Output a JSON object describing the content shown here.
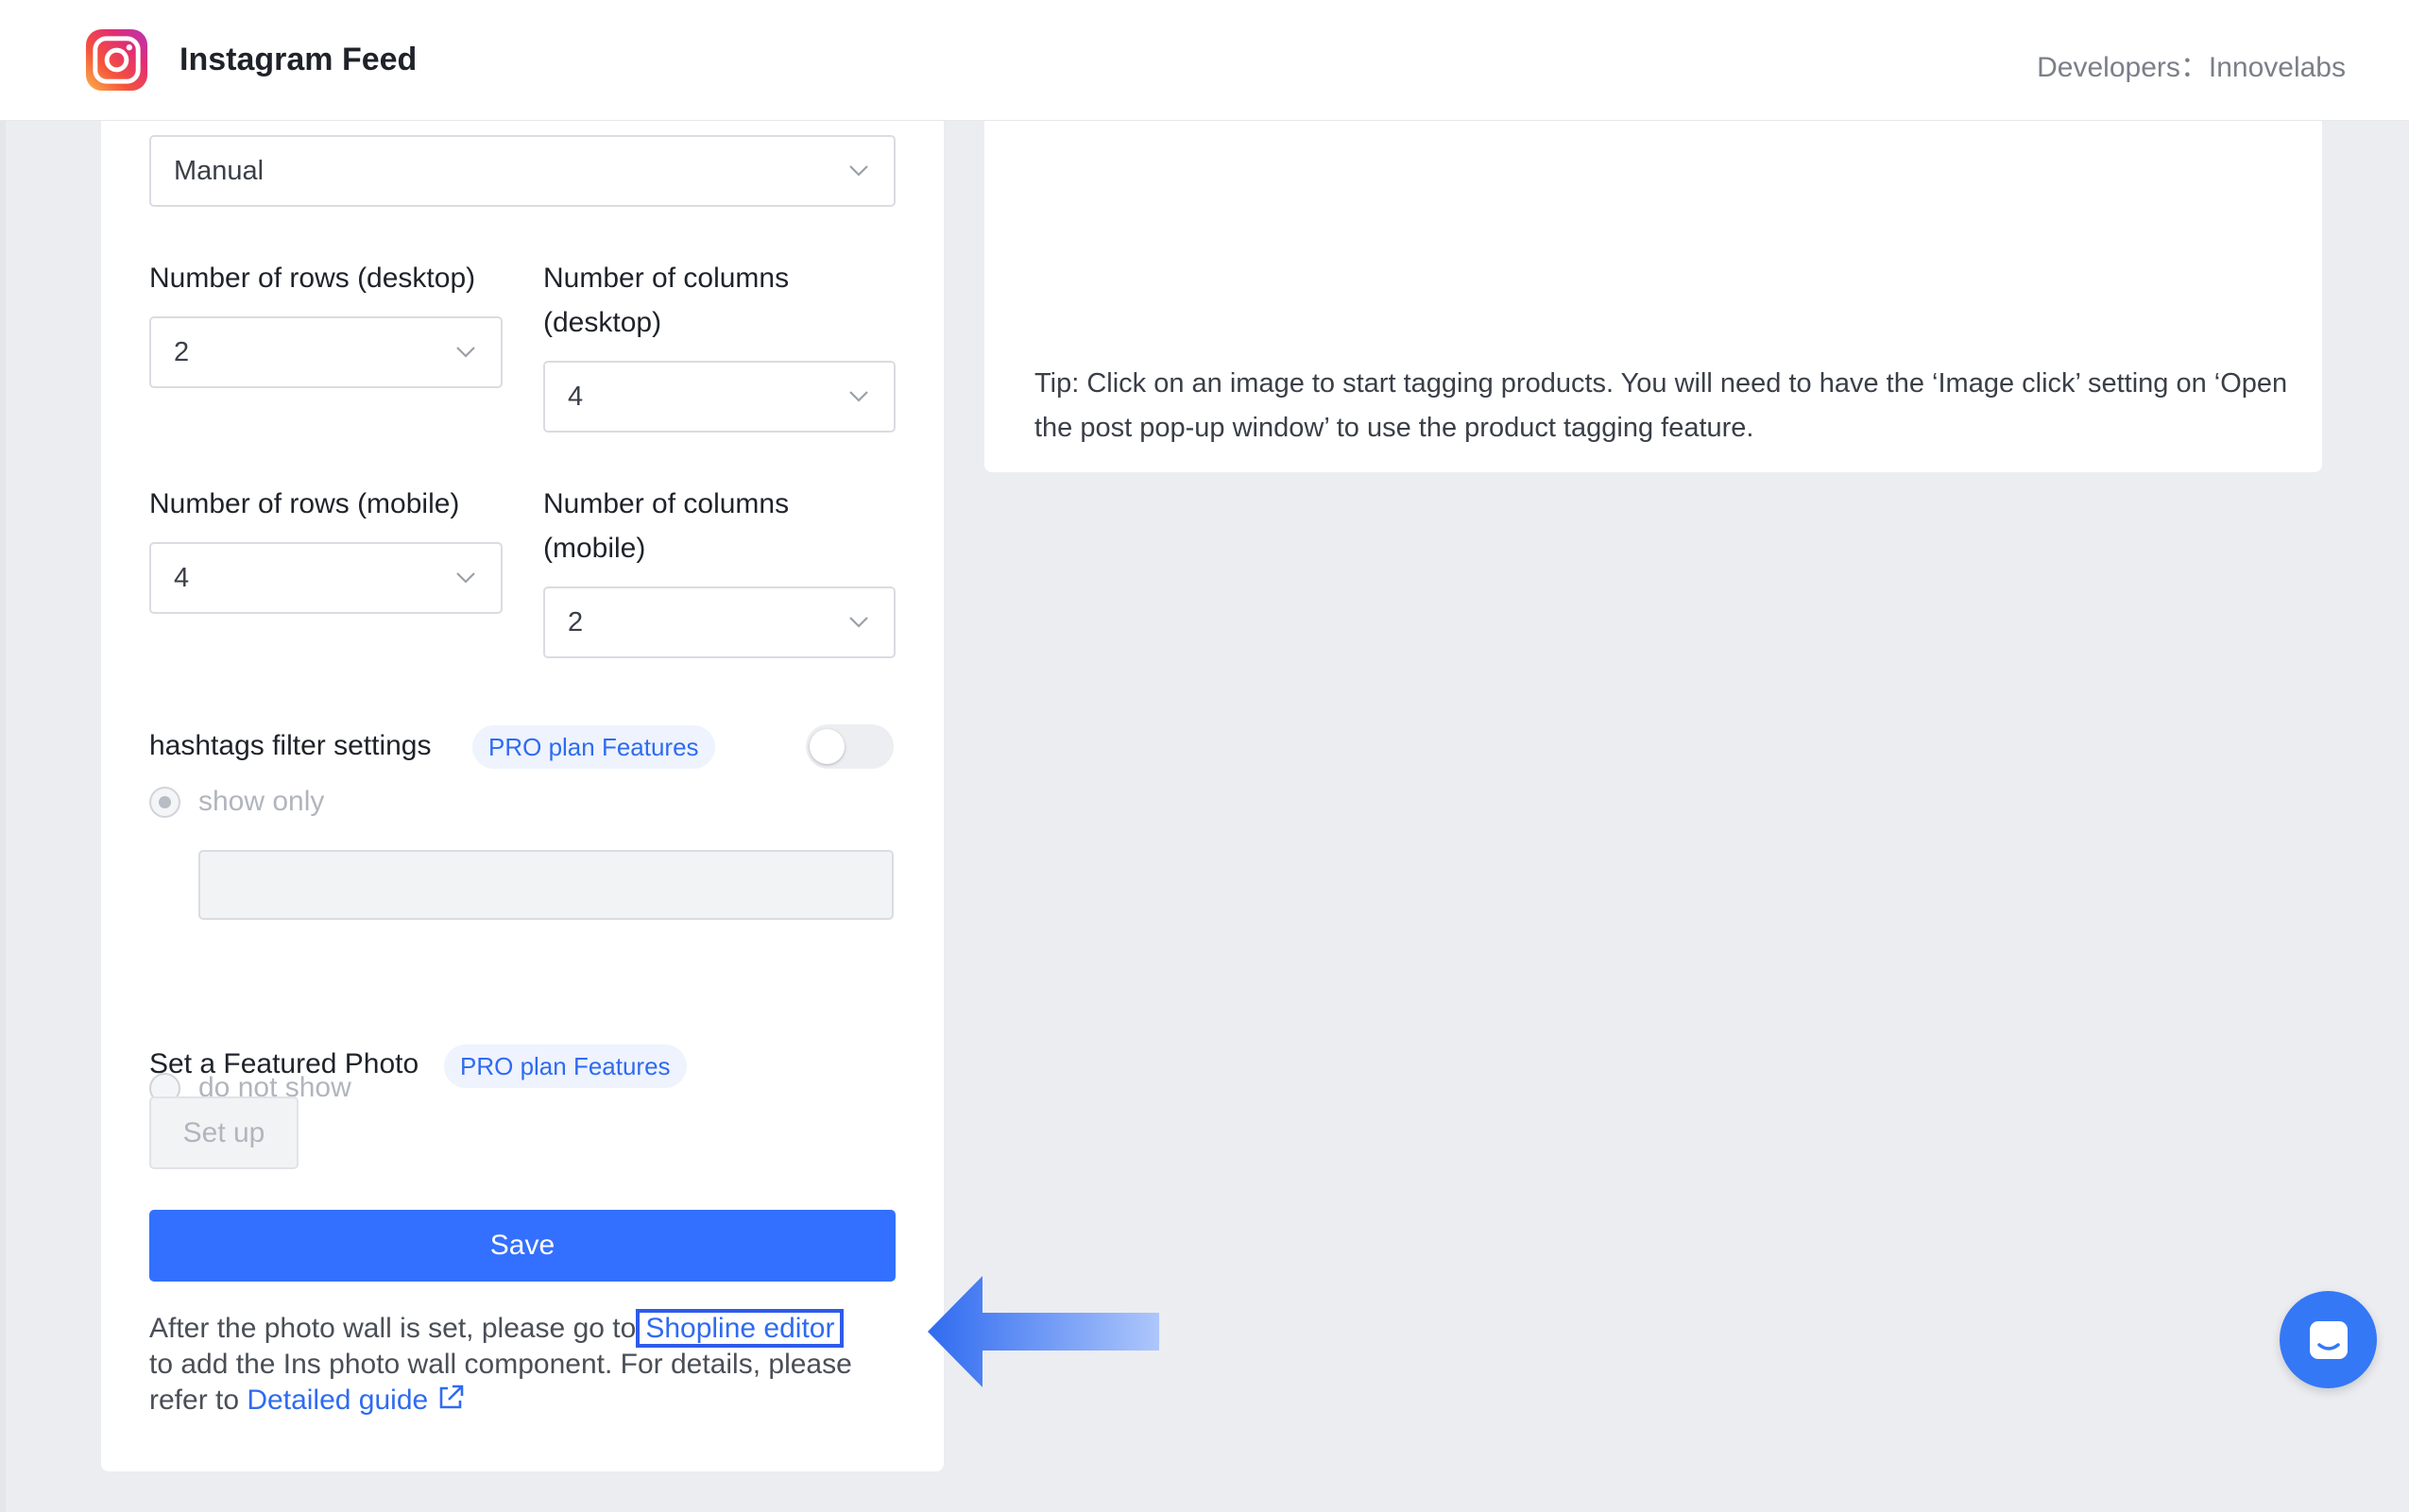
{
  "header": {
    "app_title": "Instagram Feed",
    "developers_text": "Developers：Innovelabs"
  },
  "form": {
    "mode_select": "Manual",
    "rows_desktop": {
      "label": "Number of rows (desktop)",
      "value": "2"
    },
    "cols_desktop": {
      "label_line1": "Number of columns",
      "label_line2": "(desktop)",
      "value": "4"
    },
    "rows_mobile": {
      "label": "Number of rows (mobile)",
      "value": "4"
    },
    "cols_mobile": {
      "label_line1": "Number of columns",
      "label_line2": "(mobile)",
      "value": "2"
    },
    "hashtags": {
      "label": "hashtags filter settings",
      "badge": "PRO plan Features",
      "toggle_on": false,
      "option_show_only": "show only",
      "option_do_not_show": "do not show",
      "input_value": ""
    },
    "featured_photo": {
      "label": "Set a Featured Photo",
      "badge": "PRO plan Features",
      "button": "Set up"
    },
    "save_button": "Save",
    "footer": {
      "text_before_link": "After the photo wall is set, please go to",
      "editor_link": "Shopline editor",
      "text_middle": "to add the Ins photo wall component. For details, please refer to",
      "guide_link": "Detailed guide"
    }
  },
  "preview": {
    "tip": "Tip: Click on an image to start tagging products. You will need to have the ‘Image click’ setting on ‘Open the post pop-up window’ to use the product tagging feature."
  },
  "colors": {
    "primary": "#3370ff",
    "link": "#2f6bf0",
    "badge_bg": "#eef3fd",
    "page_bg": "#ecedf1",
    "annotation_arrow": "#3a72f0"
  },
  "icons": {
    "logo": "instagram-logo",
    "chevron": "chevron-down-icon",
    "external": "external-link-icon",
    "chat": "chat-icon"
  }
}
